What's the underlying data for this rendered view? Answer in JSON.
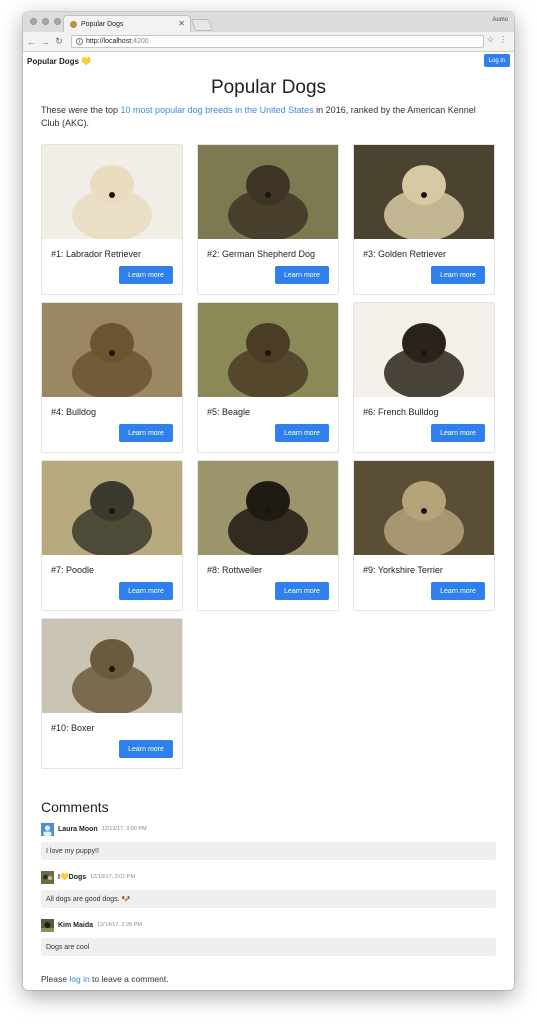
{
  "browser": {
    "tab_title": "Popular Dogs",
    "profile": "Aumo",
    "url_host": "http://localhost",
    "url_port": ":4200"
  },
  "app": {
    "brand": "Popular Dogs 💛",
    "login_label": "Log in",
    "title": "Popular Dogs",
    "intro_pre": "These were the top ",
    "intro_link": "10 most popular dog breeds in the United States",
    "intro_post": " in 2016, ranked by the American Kennel Club (AKC)."
  },
  "dogs": [
    {
      "name": "#1: Labrador Retriever",
      "button": "Learn more",
      "bg": "#f1eee8",
      "fg": "#e9dcc0"
    },
    {
      "name": "#2: German Shepherd Dog",
      "button": "Learn more",
      "bg": "#7d7a52",
      "fg": "#3d3426"
    },
    {
      "name": "#3: Golden Retriever",
      "button": "Learn more",
      "bg": "#4a4330",
      "fg": "#d7c9a3"
    },
    {
      "name": "#4: Bulldog",
      "button": "Learn more",
      "bg": "#9b8762",
      "fg": "#6a5432"
    },
    {
      "name": "#5: Beagle",
      "button": "Learn more",
      "bg": "#8b8957",
      "fg": "#4a3c25"
    },
    {
      "name": "#6: French Bulldog",
      "button": "Learn more",
      "bg": "#f3f0ea",
      "fg": "#2a231a"
    },
    {
      "name": "#7: Poodle",
      "button": "Learn more",
      "bg": "#b7aa7f",
      "fg": "#3b3a2c"
    },
    {
      "name": "#8: Rottweiler",
      "button": "Learn more",
      "bg": "#9c946a",
      "fg": "#1f1a12"
    },
    {
      "name": "#9: Yorkshire Terrier",
      "button": "Learn more",
      "bg": "#5a4f35",
      "fg": "#b5a37a"
    },
    {
      "name": "#10: Boxer",
      "button": "Learn more",
      "bg": "#c9c4b4",
      "fg": "#6c5a3d"
    }
  ],
  "comments_heading": "Comments",
  "comments": [
    {
      "author": "Laura Moon",
      "time": "12/13/17, 3:00 PM",
      "text": "I love my puppy!!"
    },
    {
      "author": "I💛Dogs",
      "time": "12/13/17, 3:01 PM",
      "text": "All dogs are good dogs. 🐶"
    },
    {
      "author": "Kim Maida",
      "time": "12/14/17, 2:26 PM",
      "text": "Dogs are cool"
    }
  ],
  "footer": {
    "pre": "Please ",
    "link": "log in",
    "post": " to leave a comment."
  }
}
